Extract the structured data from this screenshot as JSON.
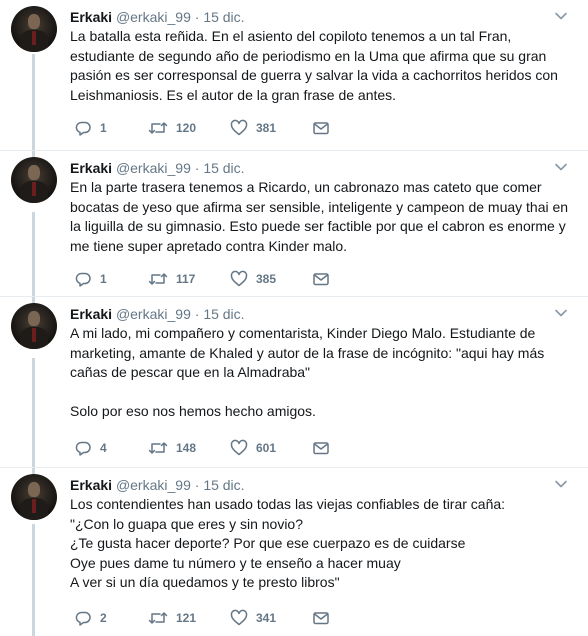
{
  "tweets": [
    {
      "name": "Erkaki",
      "handle": "@erkaki_99",
      "separator": "·",
      "date": "15 dic.",
      "lines": [
        "La batalla esta reñida. En el asiento del copiloto tenemos a un tal Fran,",
        "estudiante de segundo año de periodismo en la Uma que afirma que su gran",
        "pasión es ser corresponsal de guerra y salvar la vida a cachorritos heridos con",
        "Leishmaniosis. Es el autor de la gran frase de antes."
      ],
      "replies": "1",
      "retweets": "120",
      "likes": "381"
    },
    {
      "name": "Erkaki",
      "handle": "@erkaki_99",
      "separator": "·",
      "date": "15 dic.",
      "lines": [
        "En la parte trasera tenemos a Ricardo, un cabronazo mas cateto que comer",
        "bocatas de yeso que afirma ser sensible, inteligente y campeon de muay thai en",
        "la liguilla de su gimnasio. Esto puede ser factible por que el cabron es enorme y",
        "me tiene super apretado contra Kinder malo."
      ],
      "replies": "1",
      "retweets": "117",
      "likes": "385"
    },
    {
      "name": "Erkaki",
      "handle": "@erkaki_99",
      "separator": "·",
      "date": "15 dic.",
      "lines": [
        "A mi lado, mi compañero y comentarista, Kinder  Diego Malo. Estudiante de",
        "marketing, amante de Khaled y autor de la frase de incógnito: \"aqui hay más",
        "cañas de pescar que en la Almadraba\"",
        "",
        "Solo por eso nos hemos hecho amigos."
      ],
      "replies": "4",
      "retweets": "148",
      "likes": "601"
    },
    {
      "name": "Erkaki",
      "handle": "@erkaki_99",
      "separator": "·",
      "date": "15 dic.",
      "lines": [
        "Los contendientes han usado todas las viejas confiables de tirar caña:",
        "\"¿Con lo guapa que eres y sin novio?",
        "¿Te gusta hacer deporte? Por que ese cuerpazo es de cuidarse",
        "Oye pues dame tu número y te enseño a hacer muay",
        "A ver si un día quedamos y te presto libros\""
      ],
      "replies": "2",
      "retweets": "121",
      "likes": "341"
    }
  ],
  "icons": {
    "reply": "reply-icon",
    "retweet": "retweet-icon",
    "like": "heart-icon",
    "dm": "envelope-icon",
    "caret": "chevron-down-icon"
  },
  "colors": {
    "icon_gray": "#657786",
    "thread_line": "#ccd6dd",
    "separator": "#e6ecf0"
  }
}
